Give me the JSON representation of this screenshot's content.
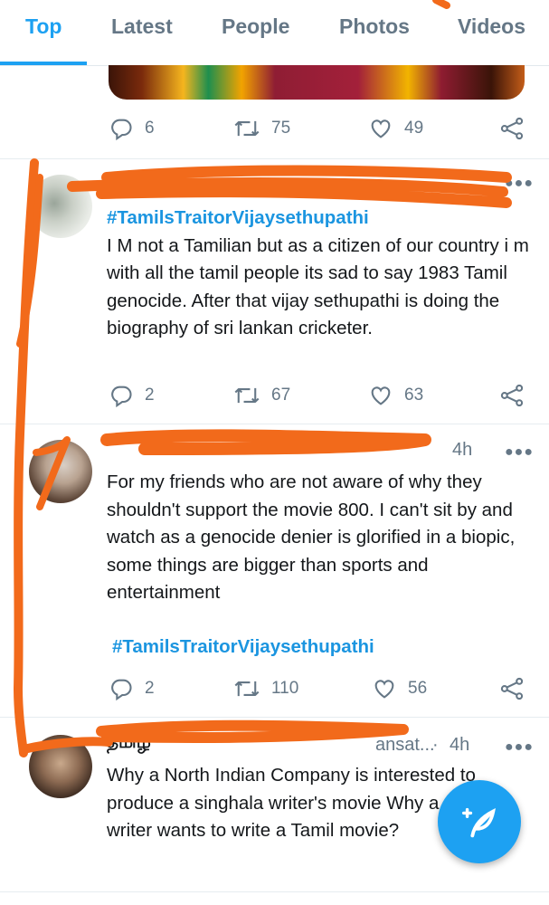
{
  "tabs": [
    {
      "label": "Top",
      "active": true
    },
    {
      "label": "Latest",
      "active": false
    },
    {
      "label": "People",
      "active": false
    },
    {
      "label": "Photos",
      "active": false
    },
    {
      "label": "Videos",
      "active": false
    }
  ],
  "tweets": [
    {
      "replies": "6",
      "retweets": "75",
      "likes": "49"
    },
    {
      "hashtag": "#TamilsTraitorVijaysethupathi",
      "text": "I M not a Tamilian but as a citizen of our country i m with all the tamil people its sad to say 1983 Tamil genocide.  After that vijay sethupathi is doing the biography of sri lankan cricketer.",
      "replies": "2",
      "retweets": "67",
      "likes": "63"
    },
    {
      "time": "4h",
      "text": "For my friends who are not aware of why they shouldn't support the movie 800. I can't sit by and watch as a genocide denier is glorified in a biopic, some things are bigger than sports and entertainment",
      "hashtag": "#TamilsTraitorVijaysethupathi",
      "replies": "2",
      "retweets": "110",
      "likes": "56"
    },
    {
      "name_partial": "தமிழ",
      "handle_partial": "ansat...",
      "time": "4h",
      "text": "Why a North Indian Company is interested to produce a singhala writer's movie Why a singhala writer wants to write a Tamil movie?"
    }
  ],
  "colors": {
    "accent": "#1da1f2",
    "hashtag": "#1b95e0",
    "muted": "#657786",
    "scribble": "#f26a1b"
  }
}
